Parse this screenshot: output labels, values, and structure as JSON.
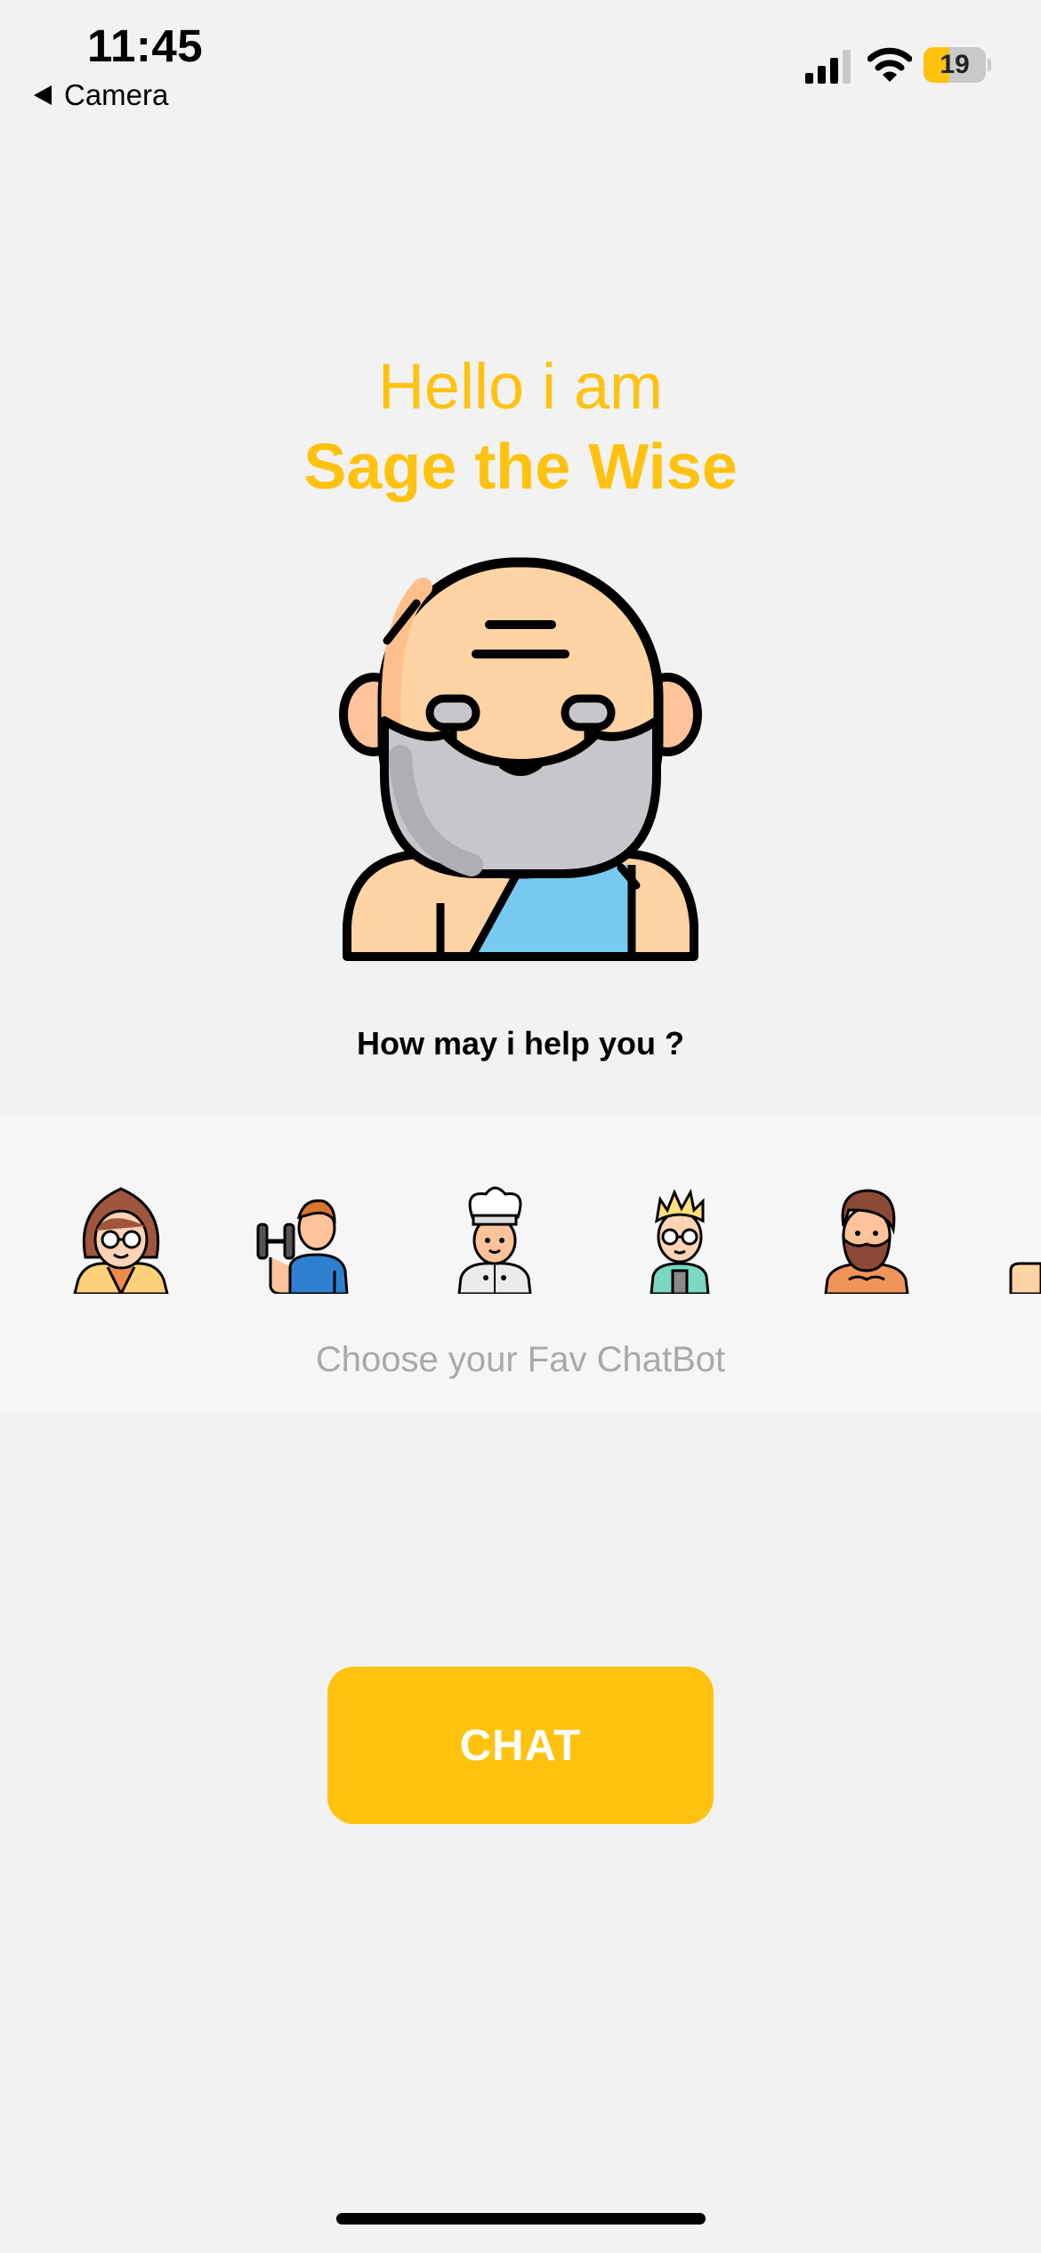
{
  "status_bar": {
    "time": "11:45",
    "back_label": "Camera",
    "battery_level": "19",
    "battery_fraction": 0.19,
    "icons": [
      "cellular-signal-icon",
      "wifi-icon",
      "battery-icon"
    ]
  },
  "hero": {
    "greeting": "Hello i am",
    "bot_name": "Sage the Wise",
    "avatar": "sage-avatar"
  },
  "help_prompt": "How may i help you ?",
  "bot_picker": {
    "label": "Choose your Fav ChatBot",
    "options": [
      {
        "avatar": "woman-glasses-avatar"
      },
      {
        "avatar": "fitness-man-avatar"
      },
      {
        "avatar": "chef-avatar"
      },
      {
        "avatar": "nerd-avatar"
      },
      {
        "avatar": "bearded-man-avatar"
      },
      {
        "avatar": "partial-avatar"
      }
    ]
  },
  "chat_button": {
    "label": "CHAT"
  },
  "colors": {
    "accent": "#ffc20e",
    "background": "#f2f2f2",
    "picker_background": "#f6f6f6",
    "muted_text": "#a9a9a9"
  }
}
